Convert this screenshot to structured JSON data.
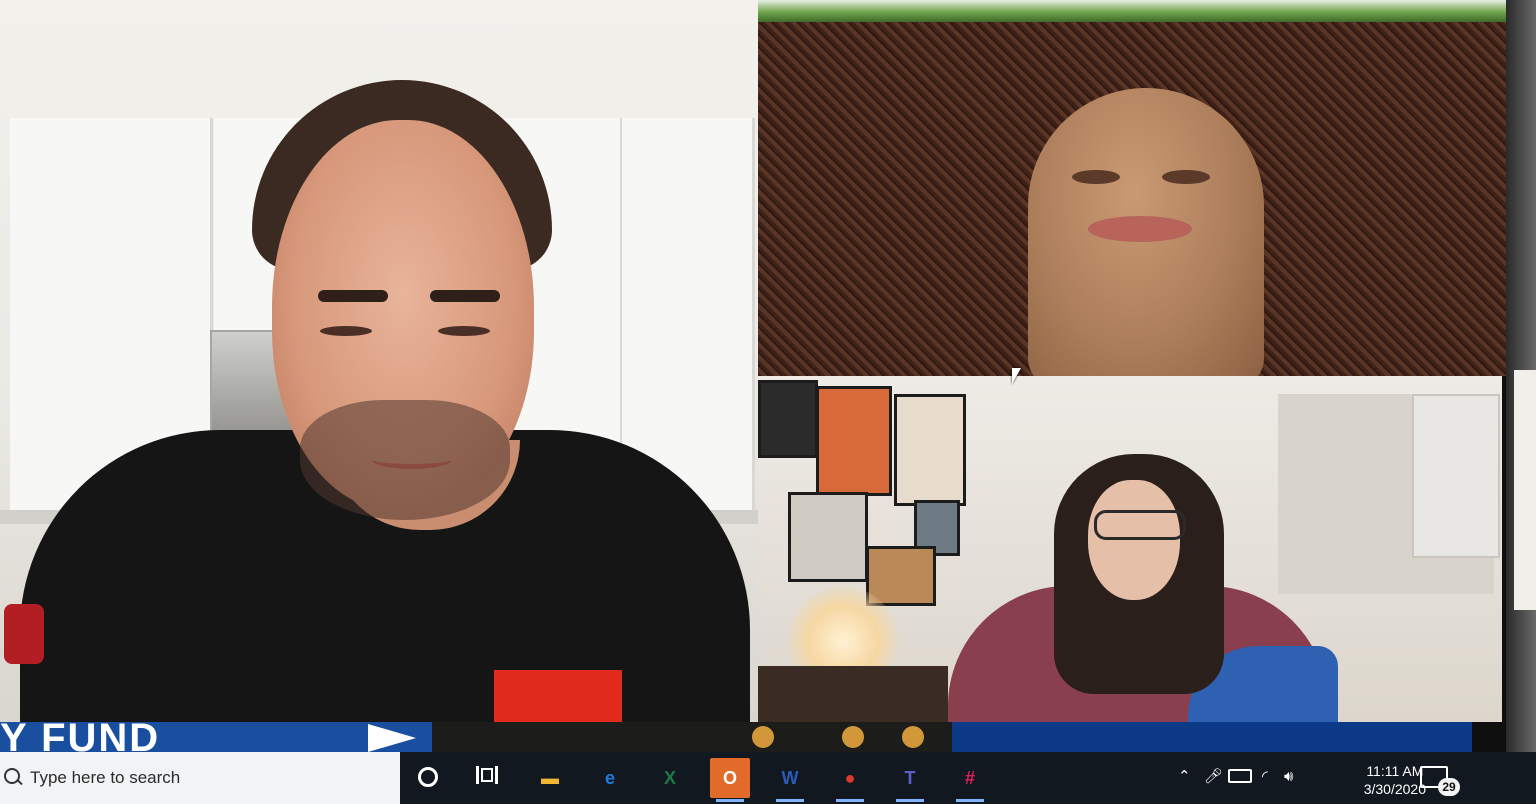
{
  "video_call": {
    "participants": [
      {
        "id": "participant-1"
      },
      {
        "id": "participant-2"
      },
      {
        "id": "participant-3"
      }
    ]
  },
  "banner": {
    "text": "Y FUND"
  },
  "taskbar": {
    "search_placeholder": "Type here to search",
    "apps": [
      {
        "name": "file-explorer",
        "glyph": "▬",
        "color": "#f2b632"
      },
      {
        "name": "edge",
        "glyph": "e",
        "color": "#1a7ddb"
      },
      {
        "name": "excel",
        "glyph": "X",
        "color": "#1e7a45"
      },
      {
        "name": "outlook",
        "glyph": "O",
        "color": "#1462c7",
        "highlight": "#e36b2a"
      },
      {
        "name": "word",
        "glyph": "W",
        "color": "#2b5ab8"
      },
      {
        "name": "chrome",
        "glyph": "●",
        "color": "#d93b2e"
      },
      {
        "name": "teams",
        "glyph": "T",
        "color": "#5b5fc7"
      },
      {
        "name": "slack",
        "glyph": "#",
        "color": "#e01e5a"
      }
    ],
    "tray": {
      "time": "11:11 AM",
      "date": "3/30/2020",
      "notification_count": "29"
    }
  }
}
